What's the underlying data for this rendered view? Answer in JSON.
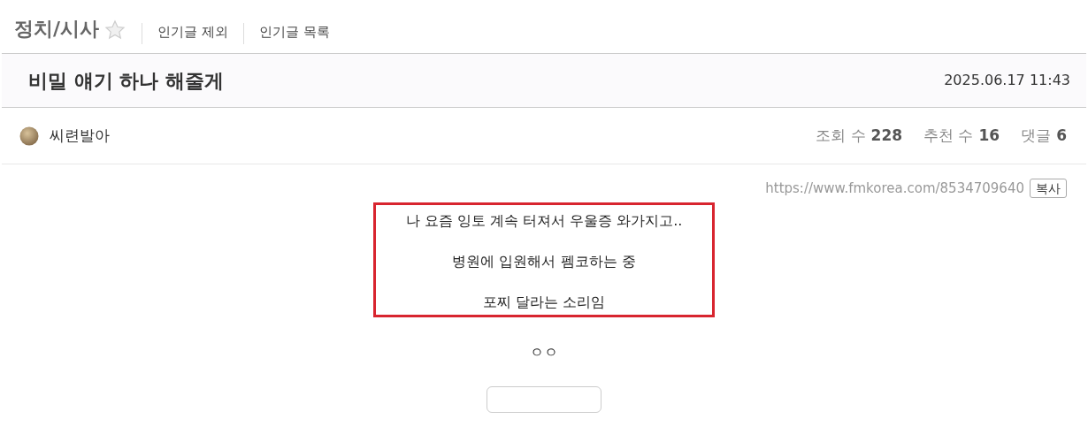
{
  "board": {
    "title": "정치/시사",
    "starred": false,
    "links": [
      "인기글 제외",
      "인기글 목록"
    ]
  },
  "post": {
    "title": "비밀 얘기 하나 해줄게",
    "date": "2025.06.17 11:43",
    "author": "씨련발아",
    "stats": [
      {
        "label": "조회 수",
        "value": "228"
      },
      {
        "label": "추천 수",
        "value": "16"
      },
      {
        "label": "댓글",
        "value": "6"
      }
    ],
    "url": "https://www.fmkorea.com/8534709640",
    "copy_button": "복사",
    "quote_lines": [
      "나 요즘 잉토 계속 터져서 우울증 와가지고..",
      "병원에 입원해서 펨코하는 중",
      "포찌 달라는 소리임"
    ],
    "footer_text": "ㅇㅇ"
  }
}
